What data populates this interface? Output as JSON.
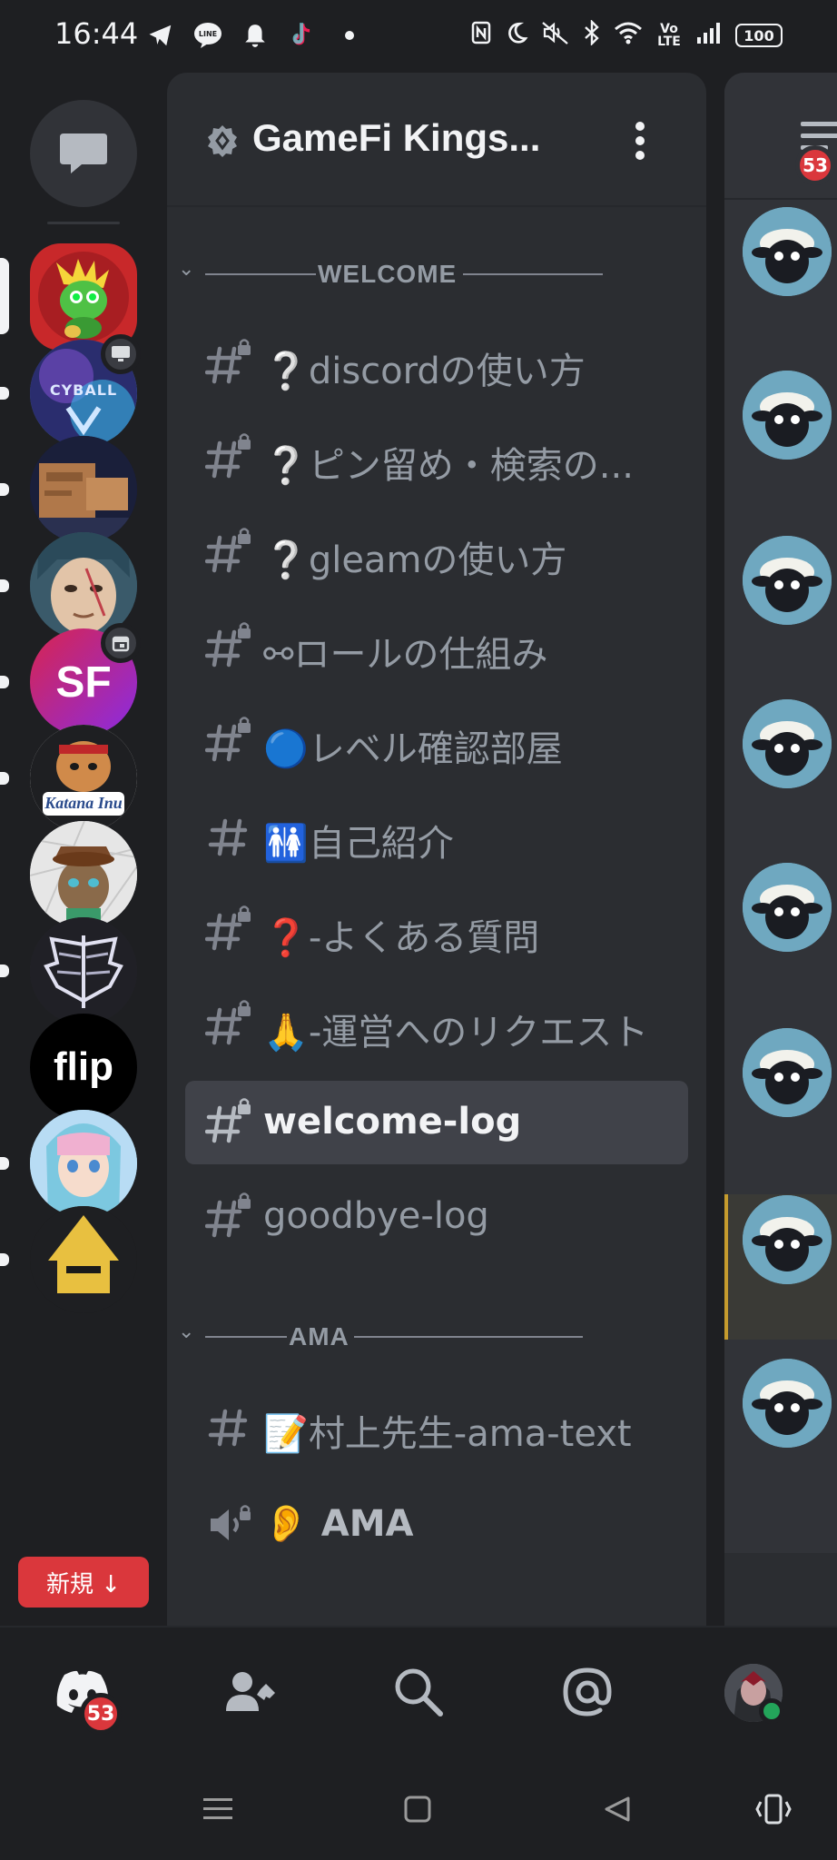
{
  "status_bar": {
    "time": "16:44",
    "left_icons": [
      "telegram-icon",
      "line-icon",
      "bell-icon",
      "tiktok-icon",
      "dot-icon"
    ],
    "line_label": "LINE",
    "right_icons": [
      "nfc-icon",
      "moon-icon",
      "mute-icon",
      "bluetooth-icon",
      "wifi-icon",
      "volte-icon",
      "signal-icon"
    ],
    "volte_label": "Vo LTE",
    "battery": "100"
  },
  "server_rail": {
    "servers": [
      {
        "name": "gamefi-kings",
        "active": true,
        "colors": [
          "#c8282a",
          "#3fae3a"
        ]
      },
      {
        "name": "cyball",
        "badge": "screen",
        "label": "CYBALL",
        "colors": [
          "#3c3f8a",
          "#5cc0e8"
        ]
      },
      {
        "name": "camera-server",
        "colors": [
          "#1a1f3a",
          "#b0784a"
        ]
      },
      {
        "name": "anime-server",
        "colors": [
          "#2b4a5a",
          "#e2c4a8"
        ]
      },
      {
        "name": "sf-server",
        "badge": "calendar",
        "label": "SF",
        "colors": [
          "#d8254f",
          "#8a2be2"
        ]
      },
      {
        "name": "katana-inu",
        "label": "Katana Inu",
        "colors": [
          "#ffffff",
          "#2a4b8c"
        ]
      },
      {
        "name": "rabbit-club",
        "colors": [
          "#e8e8e8",
          "#6a4a2a"
        ]
      },
      {
        "name": "wings-server",
        "colors": [
          "#2a2a30",
          "#d0d0e0"
        ]
      },
      {
        "name": "flip",
        "label": "flip",
        "colors": [
          "#000000",
          "#ffffff"
        ]
      },
      {
        "name": "anime-girl",
        "colors": [
          "#9ad0f0",
          "#f0b0d0"
        ]
      },
      {
        "name": "samurai",
        "colors": [
          "#e8c040",
          "#1a1a1a"
        ]
      }
    ],
    "new_button": "新規 ↓"
  },
  "guild": {
    "name": "GameFi Kings..."
  },
  "categories": [
    {
      "label": "WELCOME",
      "channels": [
        {
          "icon": "locked-text",
          "emoji": "❔",
          "name": "discordの使い方"
        },
        {
          "icon": "locked-text",
          "emoji": "❔",
          "name": "ピン留め・検索の..."
        },
        {
          "icon": "locked-text",
          "emoji": "❔",
          "name": "gleamの使い方"
        },
        {
          "icon": "locked-text",
          "emoji": "⚯",
          "name": "ロールの仕組み"
        },
        {
          "icon": "locked-text",
          "emoji": "🔵",
          "name": "レベル確認部屋"
        },
        {
          "icon": "text",
          "emoji": "🚻",
          "name": "自己紹介"
        },
        {
          "icon": "locked-text",
          "emoji": "❓",
          "name": "-よくある質問"
        },
        {
          "icon": "locked-text",
          "emoji": "🙏",
          "name": "-運営へのリクエスト"
        },
        {
          "icon": "locked-text",
          "emoji": "",
          "name": "welcome-log",
          "selected": true
        },
        {
          "icon": "locked-text",
          "emoji": "",
          "name": "goodbye-log"
        }
      ]
    },
    {
      "label": "AMA",
      "channels": [
        {
          "icon": "text",
          "emoji": "📝",
          "name": "村上先生-ama-text"
        },
        {
          "icon": "voice",
          "emoji": "👂",
          "name": "AMA"
        }
      ]
    }
  ],
  "peek": {
    "badge": "53",
    "avatar_count": 8
  },
  "bottom_nav": {
    "home_badge": "53",
    "items": [
      "discord-home-icon",
      "friends-icon",
      "search-icon",
      "mentions-icon",
      "profile-avatar"
    ]
  },
  "colors": {
    "background": "#1e1f22",
    "channel_panel": "#2b2d31",
    "selected": "#404249",
    "badge_red": "#da373c",
    "online_green": "#23a55a"
  }
}
